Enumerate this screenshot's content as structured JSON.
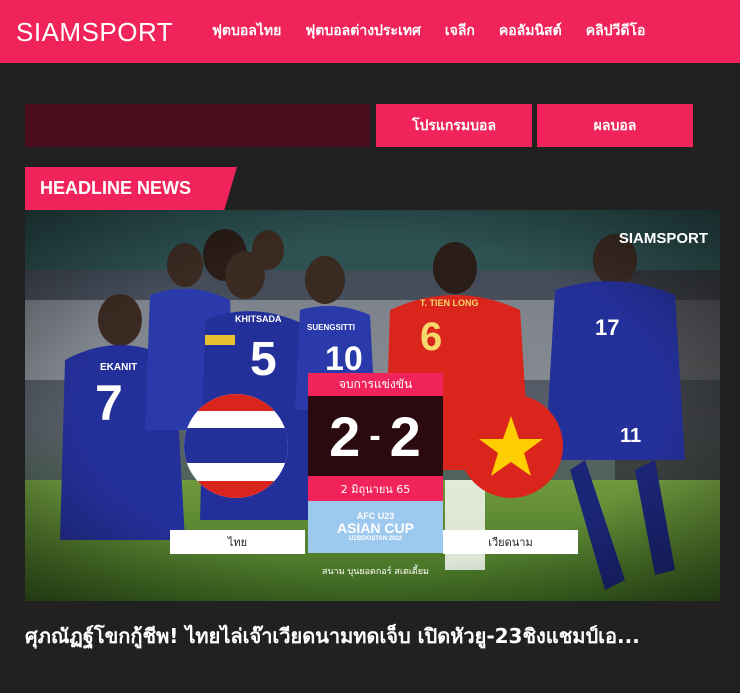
{
  "header": {
    "logo": "SIAMSPORT",
    "nav": [
      {
        "label": "ฟุตบอลไทย"
      },
      {
        "label": "ฟุตบอลต่างประเทศ"
      },
      {
        "label": "เจลีก"
      },
      {
        "label": "คอลัมนิสต์"
      },
      {
        "label": "คลิปวีดีโอ"
      }
    ]
  },
  "subnav": {
    "programs_label": "โปรแกรมบอล",
    "results_label": "ผลบอล"
  },
  "section": {
    "headline_tag": "HEADLINE NEWS"
  },
  "hero": {
    "watermark": "SIAMSPORT",
    "scoreboard": {
      "status": "จบการแข่งขัน",
      "home_score": "2",
      "separator": "-",
      "away_score": "2",
      "date": "2 มิถุนายน 65",
      "tournament_line1": "AFC U23",
      "tournament_line2": "ASIAN CUP",
      "tournament_line3": "UZBEKISTAN 2022",
      "home_team": "ไทย",
      "away_team": "เวียดนาม",
      "venue": "สนาม บุนยอดกอร์ สเตเดี้ยม"
    },
    "players": [
      {
        "name": "EKANIT",
        "number": "7"
      },
      {
        "name": "KHITSADA",
        "number": "5"
      },
      {
        "name": "SUENGSITTI",
        "number": "10"
      },
      {
        "name": "T. TIEN LONG",
        "number": "6"
      },
      {
        "number": "17"
      },
      {
        "number": "11"
      }
    ]
  },
  "article": {
    "title": "ศุภณัฏฐ์โขกกู้ชีพ! ไทยไล่เจ๊าเวียดนามทดเจ็บ เปิดหัวยู-23ชิงแชมป์เอ..."
  },
  "colors": {
    "brand": "#f0245a",
    "background": "#212121",
    "dark_bar": "#4a0e1d",
    "thai_blue": "#24309a",
    "vietnam_red": "#da251d",
    "vietnam_star": "#ffcd00"
  }
}
